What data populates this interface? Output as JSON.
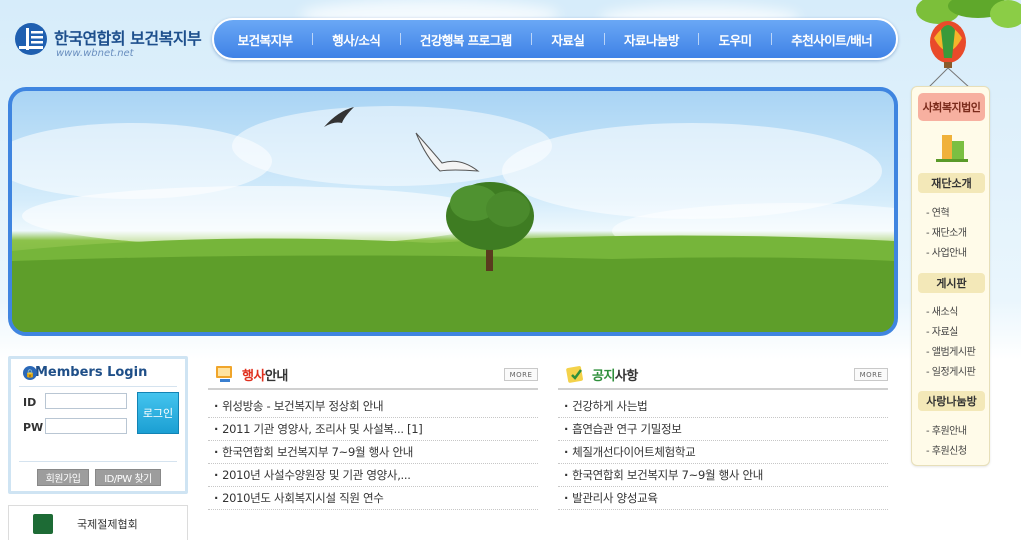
{
  "header": {
    "logo_title": "한국연합회 보건복지부",
    "logo_url": "www.wbnet.net"
  },
  "gnb": {
    "items": [
      "보건복지부",
      "행사/소식",
      "건강행복 프로그램",
      "자료실",
      "자료나눔방",
      "도우미",
      "추천사이트/배너"
    ]
  },
  "quick_menu": {
    "top": "사회복지법인",
    "sections": [
      {
        "title": "재단소개",
        "links": [
          "- 연혁",
          "- 재단소개",
          "- 사업안내"
        ]
      },
      {
        "title": "게시판",
        "links": [
          "- 새소식",
          "- 자료실",
          "- 앨범게시판",
          "- 일정게시판"
        ]
      },
      {
        "title": "사랑나눔방",
        "links": [
          "- 후원안내",
          "- 후원신청"
        ]
      }
    ]
  },
  "login": {
    "title": "Members Login",
    "id_label": "ID",
    "pw_label": "PW",
    "login_button": "로그인",
    "join_button": "회원가입",
    "find_button": "ID/PW 찾기"
  },
  "partner": {
    "name": "국제절제협회"
  },
  "board_event": {
    "title_highlight": "행사",
    "title_rest": "안내",
    "more": "MORE",
    "items": [
      "위성방송 - 보건복지부 정상회 안내",
      "2011 기관 영양사, 조리사 및 사설복... [1]",
      "한국연합회 보건복지부 7~9월 행사 안내",
      "2010년 사설수양원장 및 기관 영양사,...",
      "2010년도 사회복지시설 직원 연수"
    ]
  },
  "board_notice": {
    "title_highlight": "공지",
    "title_rest": "사항",
    "more": "MORE",
    "items": [
      "건강하게 사는법",
      "흡연습관 연구 기밀정보",
      "체질개선다이어트체험학교",
      "한국연합회 보건복지부 7~9월 행사 안내",
      "발관리사 양성교육"
    ]
  },
  "colors": {
    "gnb": "#3f82e6",
    "hero_border": "#3f85e0",
    "login_button": "#1b9fd3",
    "highlight_red": "#e0301e",
    "highlight_green": "#2f8f3b"
  }
}
